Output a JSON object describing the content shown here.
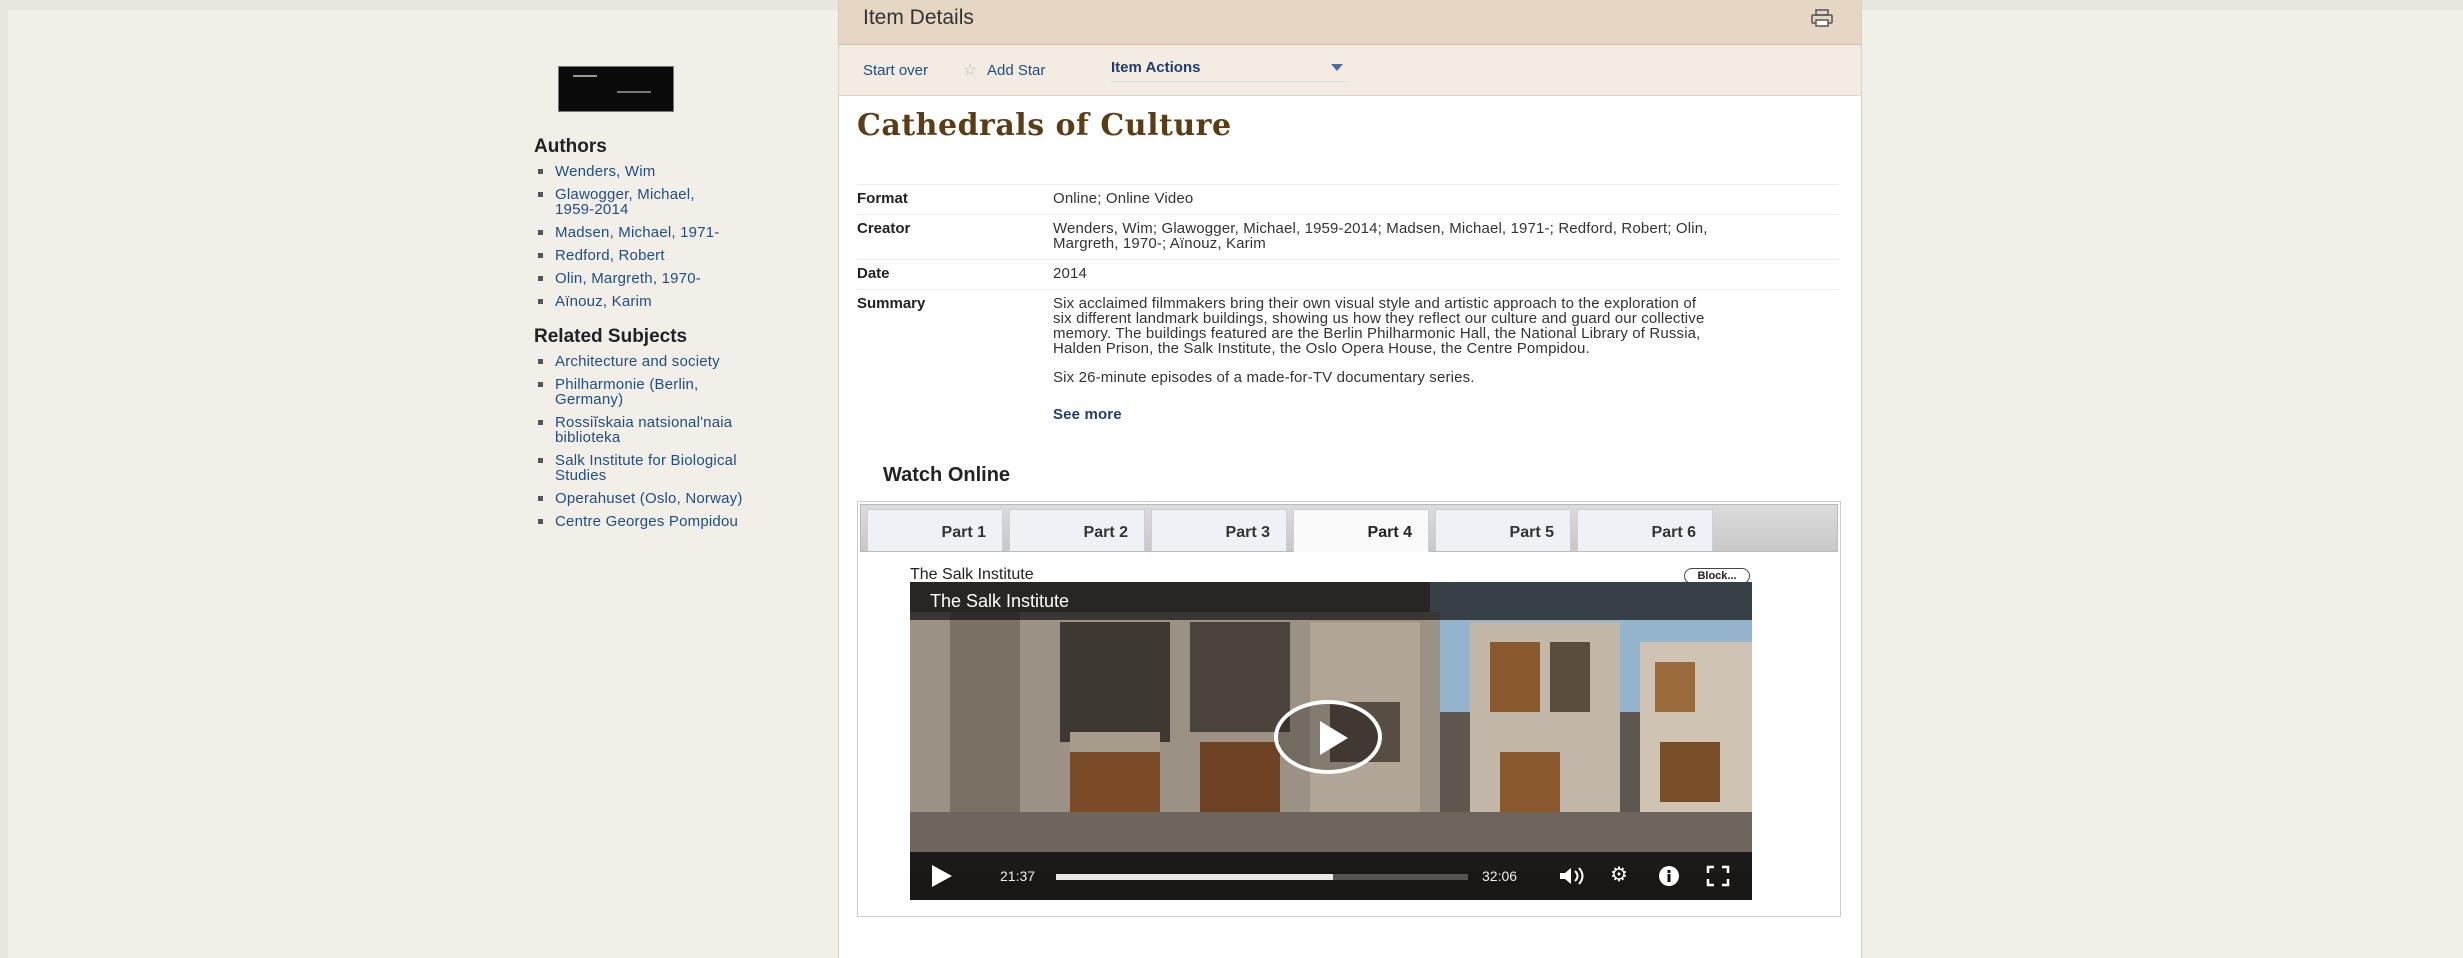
{
  "sidebar": {
    "authors_heading": "Authors",
    "authors": [
      "Wenders, Wim",
      "Glawogger, Michael,",
      "1959-2014",
      "Madsen, Michael, 1971-",
      "Redford, Robert",
      "Olin, Margreth, 1970-",
      "Aïnouz, Karim"
    ],
    "subjects_heading": "Related Subjects",
    "subjects": [
      "Architecture and society",
      "Philharmonie (Berlin,",
      "Germany)",
      "Rossiĭskaia natsionalʹnaia",
      "biblioteka",
      "Salk Institute for Biological",
      "Studies",
      "Operahuset (Oslo, Norway)",
      "Centre Georges Pompidou"
    ]
  },
  "header": {
    "title": "Item Details",
    "print_icon": "printer-icon"
  },
  "toolbar": {
    "start_over": "Start over",
    "add_star": "Add Star",
    "item_actions": "Item Actions"
  },
  "record": {
    "title": "Cathedrals of Culture",
    "format_label": "Format",
    "format_value": "Online; Online Video",
    "creator_label": "Creator",
    "creator_line1": "Wenders, Wim; Glawogger, Michael, 1959-2014; Madsen, Michael, 1971-; Redford, Robert; Olin,",
    "creator_line2": "Margreth, 1970-; Aïnouz, Karim",
    "date_label": "Date",
    "date_value": "2014",
    "summary_label": "Summary",
    "summary_p1_l1": "Six acclaimed filmmakers bring their own visual style and artistic approach to the exploration of",
    "summary_p1_l2": "six different landmark buildings, showing us how they reflect our culture and guard our collective",
    "summary_p1_l3": "memory. The buildings featured are the Berlin Philharmonic Hall, the National Library of Russia,",
    "summary_p1_l4": "Halden Prison, the Salk Institute, the Oslo Opera House, the Centre Pompidou.",
    "summary_p2": "Six 26-minute episodes of a made-for-TV documentary series.",
    "see_more": "See more"
  },
  "watch": {
    "heading": "Watch Online",
    "tabs": [
      "Part 1",
      "Part 2",
      "Part 3",
      "Part 4",
      "Part 5",
      "Part 6"
    ],
    "active_tab": "Part 4",
    "caption": "The Salk Institute",
    "block_label": "Block...",
    "video_title": "The Salk Institute",
    "current_time": "21:37",
    "duration": "32:06",
    "progress": 0.673
  }
}
